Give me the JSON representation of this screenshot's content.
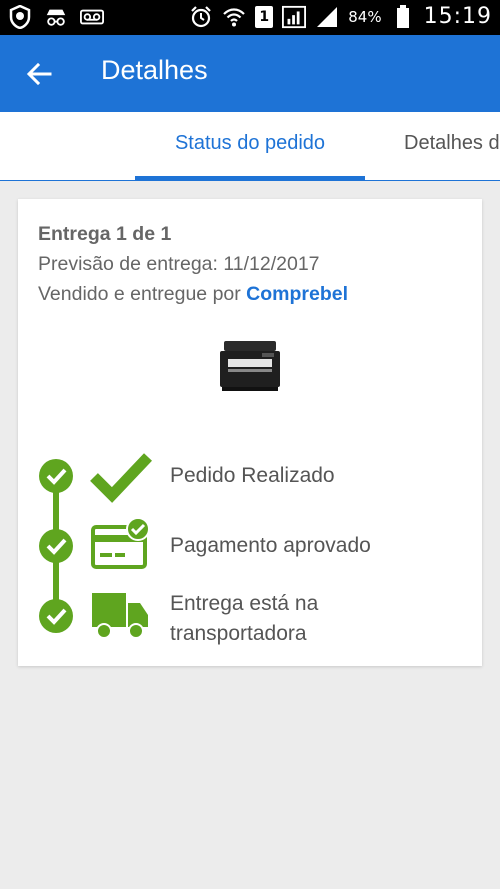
{
  "status_bar": {
    "battery": "84%",
    "time": "15:19",
    "sim": "1",
    "icons": [
      "shield-icon",
      "incognito-icon",
      "voicemail-icon",
      "alarm-icon",
      "wifi-icon",
      "sim-icon",
      "signal-icon",
      "signal-icon",
      "battery-icon"
    ]
  },
  "app_bar": {
    "title": "Detalhes",
    "back_icon": "arrow-back-icon",
    "color": "#1e73d6"
  },
  "tabs": [
    {
      "label": "Status do pedido",
      "selected": true
    },
    {
      "label": "Detalhes do",
      "selected": false
    }
  ],
  "card": {
    "delivery_title": "Entrega 1 de 1",
    "forecast": "Previsão de entrega: 11/12/2017",
    "seller_prefix": "Vendido e entregue por ",
    "seller_name": "Comprebel",
    "product_image": "printer-image"
  },
  "steps": [
    {
      "label": "Pedido Realizado",
      "icon": "checkmark-icon",
      "done": true
    },
    {
      "label": "Pagamento aprovado",
      "icon": "card-approved-icon",
      "done": true
    },
    {
      "label_line1": "Entrega está na",
      "label_line2": "transportadora",
      "icon": "truck-icon",
      "done": true
    }
  ],
  "colors": {
    "accent": "#1e73d6",
    "success": "#5fa51f"
  }
}
